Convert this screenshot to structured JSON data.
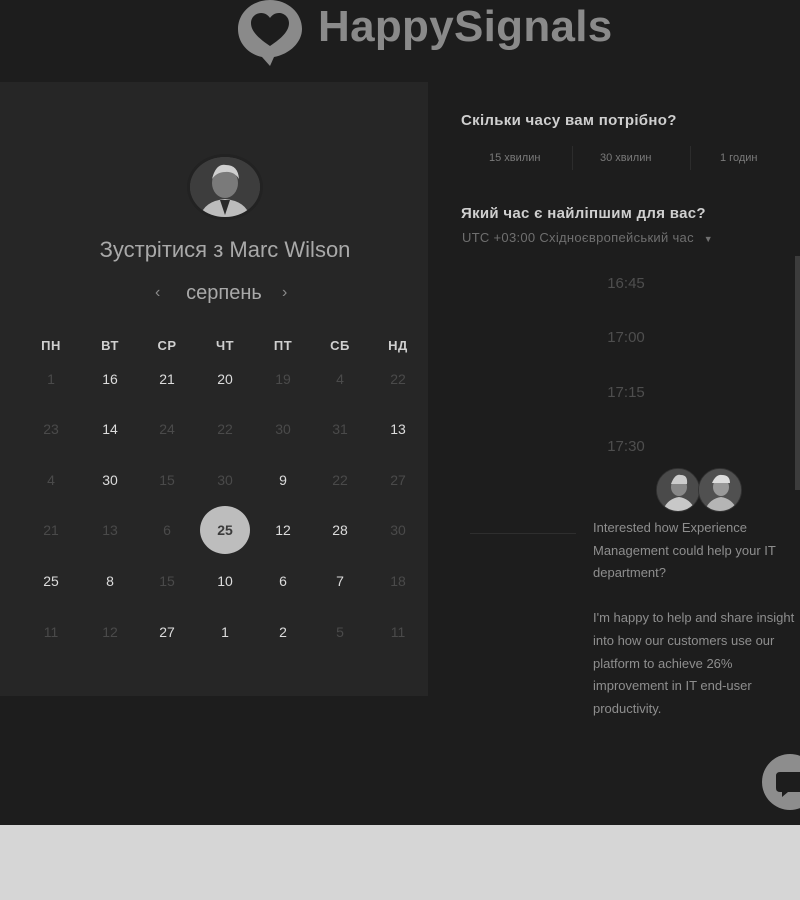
{
  "logo": {
    "text": "HappySignals"
  },
  "host": {
    "meet_title": "Зустрітися з Marc Wilson"
  },
  "calendar": {
    "month": "серпень",
    "prev_icon": "‹",
    "next_icon": "›",
    "weekdays": [
      "ПН",
      "ВТ",
      "СР",
      "ЧТ",
      "ПТ",
      "СБ",
      "НД"
    ],
    "weeks": [
      [
        {
          "d": "1",
          "on": false
        },
        {
          "d": "16",
          "on": true
        },
        {
          "d": "21",
          "on": true
        },
        {
          "d": "20",
          "on": true
        },
        {
          "d": "19",
          "on": false
        },
        {
          "d": "4",
          "on": false
        },
        {
          "d": "22",
          "on": false
        }
      ],
      [
        {
          "d": "23",
          "on": false
        },
        {
          "d": "14",
          "on": true
        },
        {
          "d": "24",
          "on": false
        },
        {
          "d": "22",
          "on": false
        },
        {
          "d": "30",
          "on": false
        },
        {
          "d": "31",
          "on": false
        },
        {
          "d": "13",
          "on": true
        }
      ],
      [
        {
          "d": "4",
          "on": false
        },
        {
          "d": "30",
          "on": true
        },
        {
          "d": "15",
          "on": false
        },
        {
          "d": "30",
          "on": false
        },
        {
          "d": "9",
          "on": true
        },
        {
          "d": "22",
          "on": false
        },
        {
          "d": "27",
          "on": false
        }
      ],
      [
        {
          "d": "21",
          "on": false
        },
        {
          "d": "13",
          "on": false
        },
        {
          "d": "6",
          "on": false
        },
        {
          "d": "25",
          "on": true,
          "selected": true
        },
        {
          "d": "12",
          "on": true
        },
        {
          "d": "28",
          "on": true
        },
        {
          "d": "30",
          "on": false
        }
      ],
      [
        {
          "d": "25",
          "on": true
        },
        {
          "d": "8",
          "on": true
        },
        {
          "d": "15",
          "on": false
        },
        {
          "d": "10",
          "on": true
        },
        {
          "d": "6",
          "on": true
        },
        {
          "d": "7",
          "on": true
        },
        {
          "d": "18",
          "on": false
        }
      ],
      [
        {
          "d": "11",
          "on": false
        },
        {
          "d": "12",
          "on": false
        },
        {
          "d": "27",
          "on": true
        },
        {
          "d": "1",
          "on": true
        },
        {
          "d": "2",
          "on": true
        },
        {
          "d": "5",
          "on": false
        },
        {
          "d": "11",
          "on": false
        }
      ]
    ]
  },
  "duration": {
    "heading": "Скільки часу вам потрібно?",
    "options": [
      "15 хвилин",
      "30 хвилин",
      "1 годин"
    ]
  },
  "time": {
    "heading": "Який час є найліпшим для вас?",
    "timezone": "UTC +03:00 Східноєвропейський час",
    "slots": [
      "16:45",
      "17:00",
      "17:15",
      "17:30"
    ]
  },
  "chat": {
    "message_1": "Interested how Experience Management could help your IT department?",
    "message_2": "I'm happy to help and share insight into how our customers use our platform to achieve 26% improvement in IT end-user productivity.",
    "launcher_icon": "chat-bubble-icon"
  },
  "colors": {
    "page": "#1d1d1d",
    "panel": "#262626",
    "selected_day": "#bdbdbd"
  }
}
